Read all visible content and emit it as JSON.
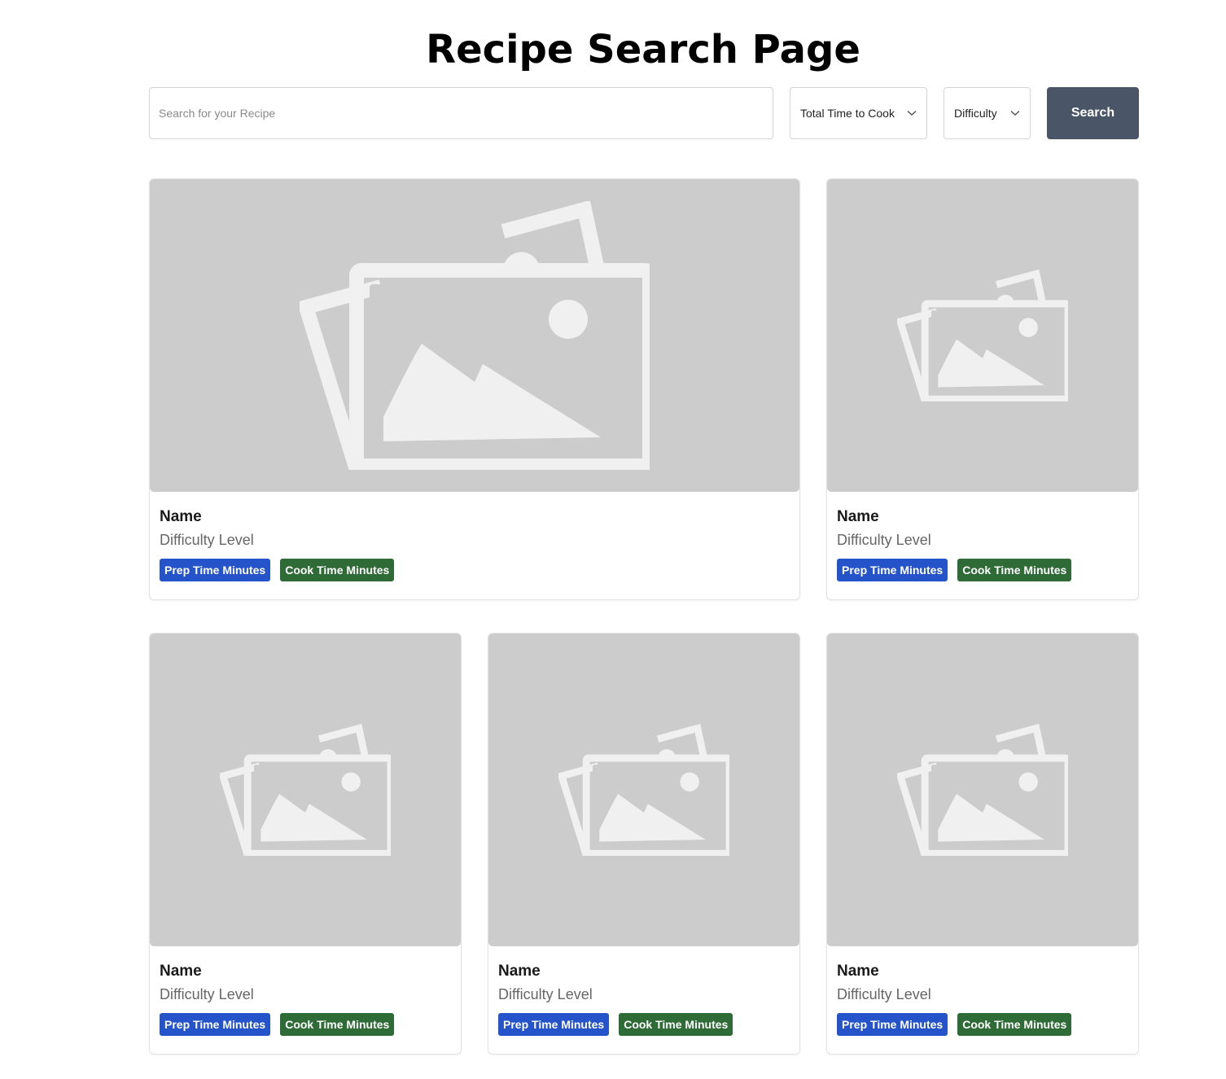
{
  "page": {
    "title": "Recipe Search Page"
  },
  "search": {
    "placeholder": "Search for your Recipe",
    "time_filter_label": "Total Time to Cook",
    "difficulty_filter_label": "Difficulty",
    "button_label": "Search"
  },
  "colors": {
    "search_button": "#4a5568",
    "prep_tag": "#2553c9",
    "cook_tag": "#2f6b36",
    "image_placeholder": "#cccccc"
  },
  "cards": [
    {
      "image_icon": "image-placeholder-icon",
      "name": "Name",
      "difficulty": "Difficulty Level",
      "prep_tag": "Prep Time Minutes",
      "cook_tag": "Cook Time Minutes"
    },
    {
      "image_icon": "image-placeholder-icon",
      "name": "Name",
      "difficulty": "Difficulty Level",
      "prep_tag": "Prep Time Minutes",
      "cook_tag": "Cook Time Minutes"
    },
    {
      "image_icon": "image-placeholder-icon",
      "name": "Name",
      "difficulty": "Difficulty Level",
      "prep_tag": "Prep Time Minutes",
      "cook_tag": "Cook Time Minutes"
    },
    {
      "image_icon": "image-placeholder-icon",
      "name": "Name",
      "difficulty": "Difficulty Level",
      "prep_tag": "Prep Time Minutes",
      "cook_tag": "Cook Time Minutes"
    },
    {
      "image_icon": "image-placeholder-icon",
      "name": "Name",
      "difficulty": "Difficulty Level",
      "prep_tag": "Prep Time Minutes",
      "cook_tag": "Cook Time Minutes"
    }
  ]
}
